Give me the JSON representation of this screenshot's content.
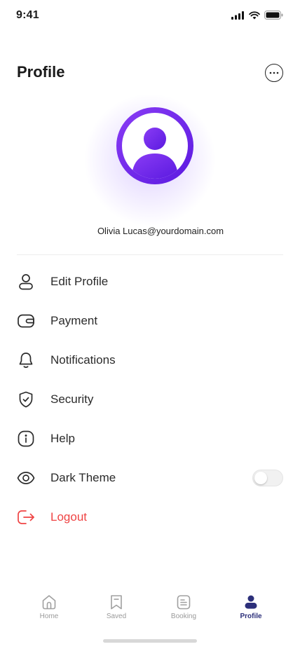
{
  "status": {
    "time": "9:41"
  },
  "header": {
    "title": "Profile",
    "more_icon": "more-horizontal-icon"
  },
  "profile": {
    "email": "Olivia Lucas@yourdomain.com",
    "avatar_icon": "user-avatar-icon"
  },
  "colors": {
    "accent": "#6a24ea",
    "danger": "#ef4444",
    "active_tab": "#2c2f7a",
    "muted": "#9a9a9a"
  },
  "menu": {
    "items": [
      {
        "label": "Edit Profile",
        "icon": "user-icon"
      },
      {
        "label": "Payment",
        "icon": "wallet-icon"
      },
      {
        "label": "Notifications",
        "icon": "bell-icon"
      },
      {
        "label": "Security",
        "icon": "shield-check-icon"
      },
      {
        "label": "Help",
        "icon": "info-icon"
      },
      {
        "label": "Dark Theme",
        "icon": "eye-icon",
        "toggle_on": false
      },
      {
        "label": "Logout",
        "icon": "logout-icon"
      }
    ]
  },
  "tabbar": {
    "tabs": [
      {
        "label": "Home",
        "icon": "home-icon",
        "active": false
      },
      {
        "label": "Saved",
        "icon": "bookmark-icon",
        "active": false
      },
      {
        "label": "Booking",
        "icon": "document-icon",
        "active": false
      },
      {
        "label": "Profile",
        "icon": "profile-icon",
        "active": true
      }
    ]
  }
}
